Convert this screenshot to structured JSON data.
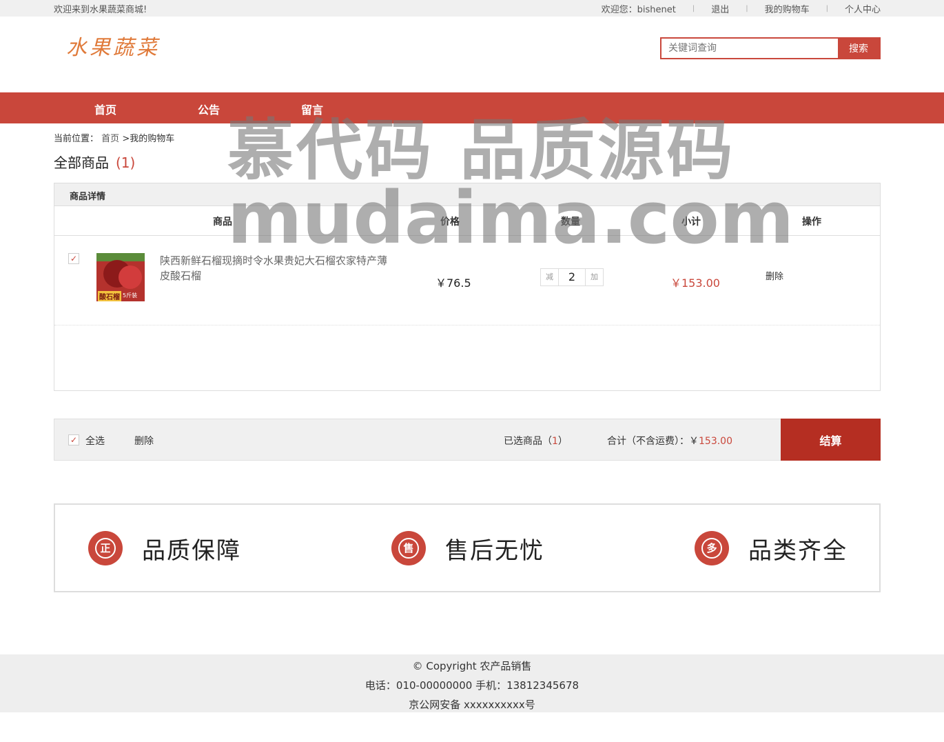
{
  "topbar": {
    "welcome": "欢迎来到水果蔬菜商城!",
    "user": "欢迎您：bishenet",
    "logout": "退出",
    "my_cart": "我的购物车",
    "personal": "个人中心",
    "sep": "|"
  },
  "header": {
    "logo": "水果蔬菜",
    "search_placeholder": "关键词查询",
    "search_button": "搜索"
  },
  "nav": {
    "home": "首页",
    "notice": "公告",
    "message": "留言"
  },
  "watermark": {
    "line1": "慕代码 品质源码",
    "line2": "mudaima.com"
  },
  "breadcrumb": {
    "prefix": "当前位置：",
    "home": "首页",
    "arrow": ">",
    "current": "我的购物车"
  },
  "cart_title": {
    "label": "全部商品",
    "count": "(1)"
  },
  "table": {
    "header": "商品详情",
    "columns": {
      "product": "商品",
      "price": "价格",
      "qty": "数量",
      "subtotal": "小计",
      "action": "操作"
    },
    "rows": [
      {
        "checked": "✓",
        "thumb_label": "酸石榴",
        "thumb_sub": "5斤装",
        "name": "陕西新鲜石榴现摘时令水果贵妃大石榴农家特产薄皮酸石榴",
        "price": "￥76.5",
        "dec": "减",
        "qty": "2",
        "inc": "加",
        "subtotal": "￥153.00",
        "delete": "删除"
      }
    ]
  },
  "summary": {
    "check": "✓",
    "select_all": "全选",
    "delete": "删除",
    "selected_label": "已选商品（",
    "selected_count": "1",
    "selected_end": "）",
    "total_label": "合计（不含运费）：￥",
    "total_value": "153.00",
    "checkout": "结算"
  },
  "features": [
    {
      "icon": "正",
      "text": "品质保障"
    },
    {
      "icon": "售",
      "text": "售后无忧"
    },
    {
      "icon": "多",
      "text": "品类齐全"
    }
  ],
  "footer": {
    "copyright": "© Copyright 农产品销售",
    "contact": "电话：010-00000000 手机：13812345678",
    "icp": "京公网安备 xxxxxxxxxx号"
  }
}
